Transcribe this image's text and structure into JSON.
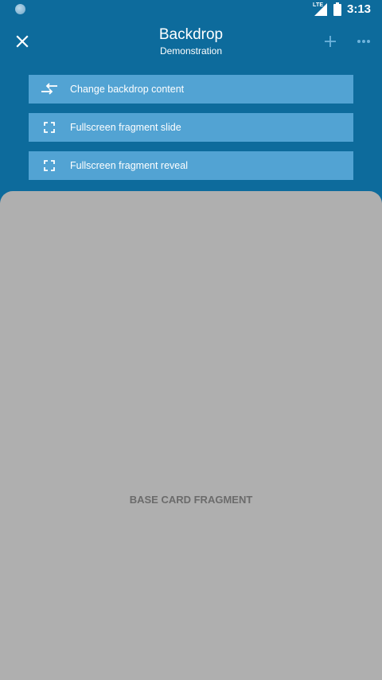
{
  "status_bar": {
    "network_label": "LTE",
    "time": "3:13"
  },
  "toolbar": {
    "title": "Backdrop",
    "subtitle": "Demonstration",
    "icons": {
      "close": "close-icon",
      "add": "add-icon",
      "more": "more-horizontal-icon"
    }
  },
  "menu": {
    "items": [
      {
        "label": "Change backdrop content",
        "icon": "swap-icon"
      },
      {
        "label": "Fullscreen fragment slide",
        "icon": "fullscreen-icon"
      },
      {
        "label": "Fullscreen fragment reveal",
        "icon": "fullscreen-icon"
      }
    ]
  },
  "front_layer": {
    "label": "BASE CARD FRAGMENT"
  },
  "colors": {
    "backdrop": "#0d6b9c",
    "menu_item": "#52a3d3",
    "front_layer": "#afafaf",
    "fragment_text": "#6b6b6b"
  }
}
